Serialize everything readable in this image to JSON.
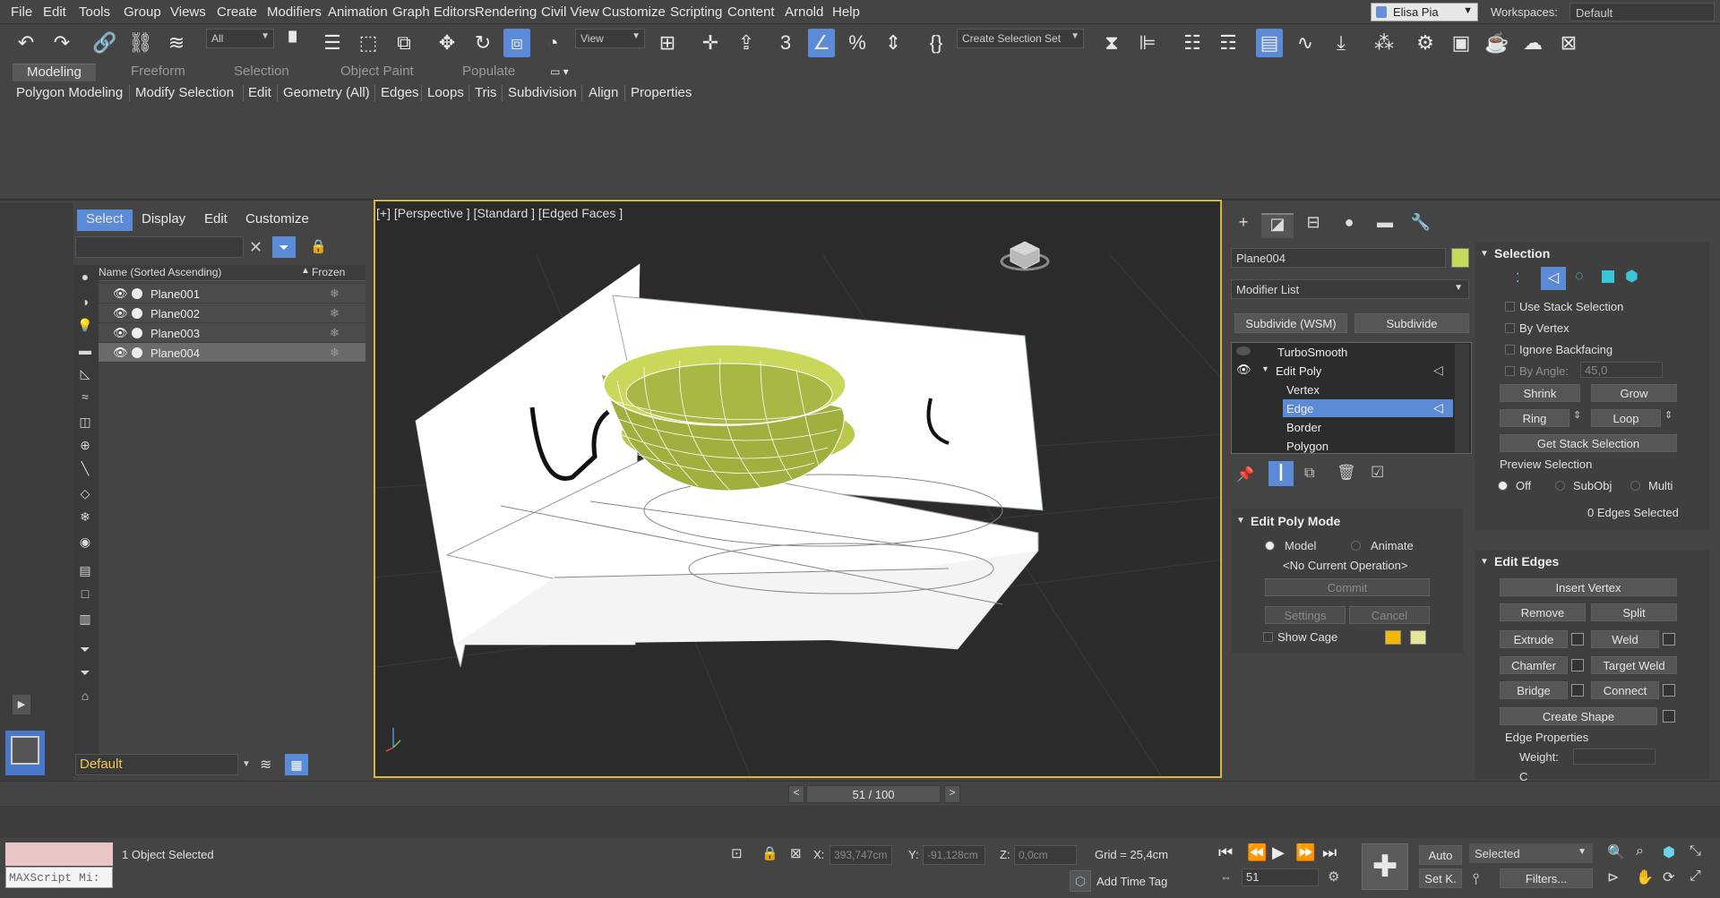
{
  "menu": [
    "File",
    "Edit",
    "Tools",
    "Group",
    "Views",
    "Create",
    "Modifiers",
    "Animation",
    "Graph Editors",
    "Rendering",
    "Civil View",
    "Customize",
    "Scripting",
    "Content",
    "Arnold",
    "Help"
  ],
  "user": "Elisa Pia",
  "workspaces_label": "Workspaces:",
  "workspace": "Default",
  "toolbar": {
    "filter_value": "All",
    "view_value": "View",
    "selection_set": "Create Selection Set"
  },
  "ribbon": {
    "tabs": [
      "Modeling",
      "Freeform",
      "Selection",
      "Object Paint",
      "Populate"
    ],
    "subtabs": [
      "Polygon Modeling",
      "Modify Selection",
      "Edit",
      "Geometry (All)",
      "Edges",
      "Loops",
      "Tris",
      "Subdivision",
      "Align",
      "Properties"
    ]
  },
  "explorer": {
    "tabs": [
      "Select",
      "Display",
      "Edit",
      "Customize"
    ],
    "header_name": "Name (Sorted Ascending)",
    "header_frozen": "Frozen",
    "rows": [
      "Plane001",
      "Plane002",
      "Plane003",
      "Plane004"
    ],
    "layer": "Default"
  },
  "viewport": {
    "label": "[+] [Perspective ] [Standard ] [Edged Faces ]"
  },
  "command_panel": {
    "object_name": "Plane004",
    "object_color": "#c5d95a",
    "modifier_list": "Modifier List",
    "subdivide_wsm": "Subdivide (WSM)",
    "subdivide": "Subdivide",
    "stack": {
      "turbosmooth": "TurboSmooth",
      "editpoly": "Edit Poly",
      "vertex": "Vertex",
      "edge": "Edge",
      "border": "Border",
      "polygon": "Polygon"
    },
    "edit_poly_mode": {
      "title": "Edit Poly Mode",
      "model": "Model",
      "animate": "Animate",
      "current_op": "<No Current Operation>",
      "commit": "Commit",
      "settings": "Settings",
      "cancel": "Cancel",
      "show_cage": "Show Cage"
    },
    "selection": {
      "title": "Selection",
      "use_stack": "Use Stack Selection",
      "by_vertex": "By Vertex",
      "ignore_backfacing": "Ignore Backfacing",
      "by_angle": "By Angle:",
      "angle_value": "45,0",
      "shrink": "Shrink",
      "grow": "Grow",
      "ring": "Ring",
      "loop": "Loop",
      "get_stack": "Get Stack Selection",
      "preview": "Preview Selection",
      "off": "Off",
      "subobj": "SubObj",
      "multi": "Multi",
      "count": "0 Edges Selected"
    },
    "edit_edges": {
      "title": "Edit Edges",
      "insert_vertex": "Insert Vertex",
      "remove": "Remove",
      "split": "Split",
      "extrude": "Extrude",
      "weld": "Weld",
      "chamfer": "Chamfer",
      "target_weld": "Target Weld",
      "bridge": "Bridge",
      "connect": "Connect",
      "create_shape": "Create Shape",
      "edge_properties": "Edge Properties",
      "weight": "Weight:",
      "crease": "C"
    }
  },
  "timeline": {
    "frame": "51 / 100"
  },
  "status": {
    "maxscript": "MAXScript Mi:",
    "selected": "1 Object Selected",
    "x_label": "X:",
    "x": "393,747cm",
    "y_label": "Y:",
    "y": "-91,128cm",
    "z_label": "Z:",
    "z": "0,0cm",
    "grid": "Grid = 25,4cm",
    "add_time_tag": "Add Time Tag",
    "auto": "Auto",
    "set_key": "Set K.",
    "key_filter": "Selected",
    "filters": "Filters...",
    "frame_value": "51"
  }
}
